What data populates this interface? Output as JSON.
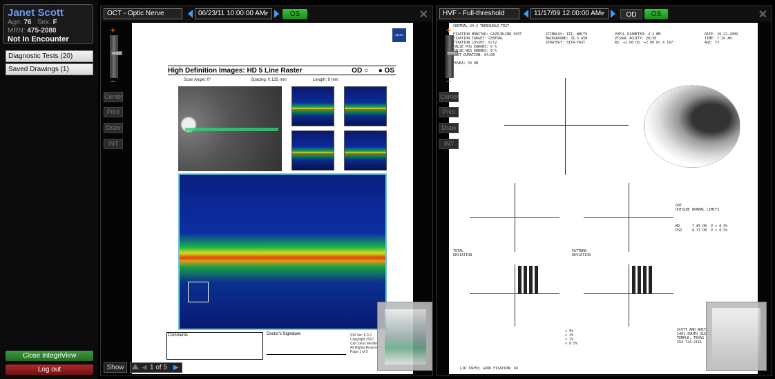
{
  "patient": {
    "name": "Janet Scott",
    "age_label": "Age:",
    "age": "76",
    "sex_label": "Sex:",
    "sex": "F",
    "mrn_label": "MRN:",
    "mrn": "475-2080",
    "encounter": "Not In Encounter"
  },
  "sidebar": {
    "items": [
      {
        "label": "Diagnostic Tests (20)"
      },
      {
        "label": "Saved Drawings (1)"
      }
    ],
    "close_label": "Close IntegriView",
    "logout_label": "Log out"
  },
  "tools": {
    "plus": "+",
    "minus": "−",
    "buttons": [
      "Center",
      "Print",
      "Draw",
      "INT"
    ]
  },
  "left_panel": {
    "title": "OCT - Optic Nerve",
    "date": "06/23/11 10:00:00 AM",
    "eye": "OS",
    "show_label": "Show",
    "page_label": "1 of 5",
    "report": {
      "title": "High Definition Images: HD 5 Line Raster",
      "od": "OD",
      "os": "OS",
      "scan_angle": "Scan Angle: 0°",
      "spacing": "Spacing: 0.125 mm",
      "length": "Length: 9 mm",
      "comments": "Comments",
      "signature": "Doctor's Signature",
      "sw": "SW Ver: 6.0.2\nCopyright 2012\nCarl Zeiss Meditec\nAll Rights Reserved\nPage 1 of 5",
      "logo": "ZEISS"
    }
  },
  "right_panel": {
    "title": "HVF - Full-threshold",
    "date": "11/17/09 12:00:00 AM",
    "eye_od": "OD",
    "eye_os": "OS",
    "report": {
      "header_left": "CENTRAL 24-2 THRESHOLD TEST\n\nFIXATION MONITOR: GAZE/BLIND SPOT\nFIXATION TARGET: CENTRAL\nFIXATION LOSSES: 0/12\nFALSE POS ERRORS: 0 %\nFALSE NEG ERRORS: 0 %\nTEST DURATION: 04:00\n\nFOVEA: 33 DB",
      "header_mid": "STIMULUS: III, WHITE\nBACKGROUND: 31.5 ASB\nSTRATEGY: SITA-FAST",
      "header_pupil": "PUPIL DIAMETER: 4.2 MM\nVISUAL ACUITY: 20/30\nRX: +2.00 DS  +2.00 DC X 167",
      "header_right": "DATE: 10-22-2009\nTIME: 7:16 AM\nAGE: 73",
      "ght": "GHT\nOUTSIDE NORMAL LIMITS\n\n\n\nMD     -7.85 DB  P < 0.5%\nPSD     8.37 DB  P < 0.5%",
      "total_dev": "TOTAL\nDEVIATION",
      "pattern_dev": "PATTERN\nDEVIATION",
      "footer": "LID TAPED; GOOD FIXATION; RX",
      "clinic": "SCOTT AND WHITE\n1401 SOUTH 31ST\nTEMPLE, TEXAS 7\n254 724-2111",
      "legend": "< 5%\n< 2%\n< 1%\n< 0.5%"
    }
  }
}
